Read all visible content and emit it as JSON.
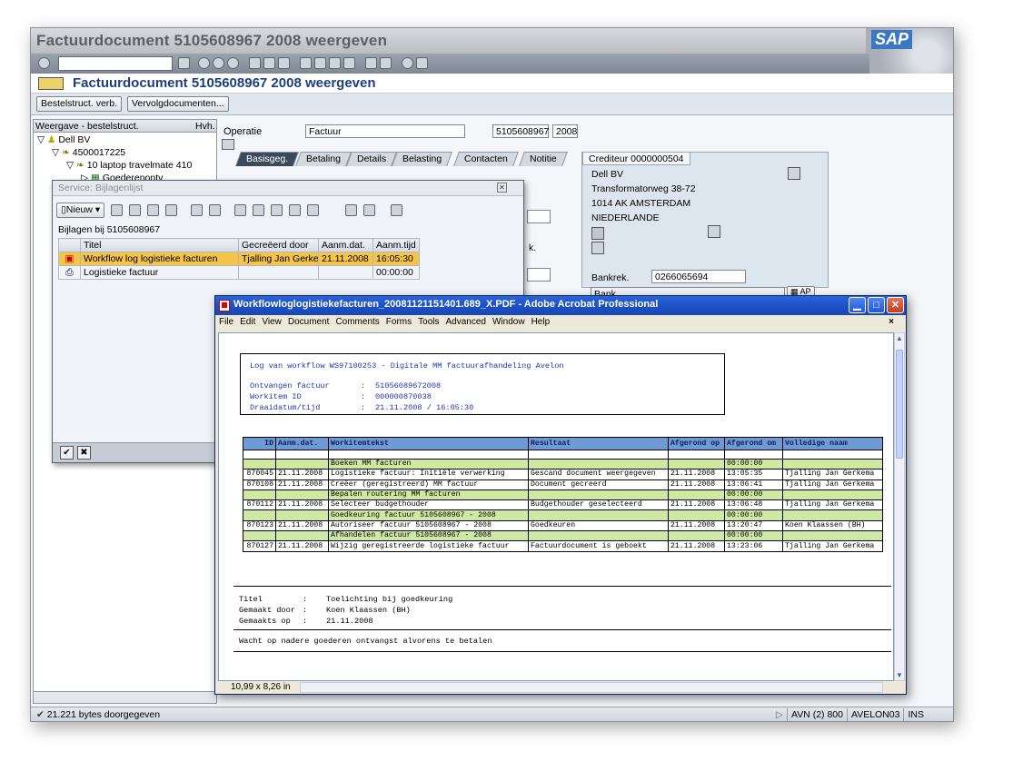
{
  "sap": {
    "title": "Factuurdocument 5105608967 2008 weergeven",
    "logo": "SAP",
    "header_title": "Factuurdocument 5105608967 2008 weergeven",
    "buttons": {
      "bestelstruct": "Bestelstruct. verb.",
      "vervolg": "Vervolgdocumenten..."
    },
    "tree": {
      "col1": "Weergave - bestelstruct.",
      "col2": "Hvh.",
      "items": [
        "Dell BV",
        "4500017225",
        "10 laptop travelmate 410",
        "Goederenontv."
      ]
    },
    "operatie_label": "Operatie",
    "operatie_value": "Factuur",
    "doc_number": "5105608967",
    "doc_year": "2008",
    "tabs": [
      "Basisgeg.",
      "Betaling",
      "Details",
      "Belasting",
      "Contacten",
      "Notitie"
    ],
    "crediteur": {
      "title": "Crediteur 0000000504",
      "lines": [
        "Dell BV",
        "Transformatorweg 38-72",
        "1014 AK AMSTERDAM",
        "NIEDERLANDE"
      ],
      "bankrek_label": "Bankrek.",
      "bankrek_value": "0266065694",
      "bank_label": "Bank",
      "ap_button": "AP"
    },
    "partial_labels": {
      "k": "k."
    },
    "status": {
      "message": "21.221 bytes doorgegeven",
      "system": "AVN (2) 800",
      "server": "AVELON03",
      "mode": "INS"
    }
  },
  "bijlagen": {
    "title": "Service: Bijlagenlijst",
    "nieuw": "Nieuw",
    "label": "Bijlagen bij 5105608967",
    "columns": [
      "Titel",
      "Gecreëerd door",
      "Aanm.dat.",
      "Aanm.tijd"
    ],
    "rows": [
      {
        "titel": "Workflow log logistieke facturen",
        "door": "Tjalling Jan Gerkema",
        "datum": "21.11.2008",
        "tijd": "16:05:30"
      },
      {
        "titel": "Logistieke factuur",
        "door": "",
        "datum": "",
        "tijd": "00:00:00"
      }
    ]
  },
  "acrobat": {
    "title": "Workflowloglogistiekefacturen_20081121151401.689_X.PDF - Adobe Acrobat Professional",
    "menu": [
      "File",
      "Edit",
      "View",
      "Document",
      "Comments",
      "Forms",
      "Tools",
      "Advanced",
      "Window",
      "Help"
    ],
    "page_size": "10,99 x 8,26 in",
    "doc": {
      "log_title": "Log van workflow WS97100253  - Digitale MM factuurafhandeling Avelon",
      "meta": [
        {
          "label": "Ontvangen factuur",
          "value": "51056089672008"
        },
        {
          "label": "Workitem ID",
          "value": "000000870038"
        },
        {
          "label": "Draaidatum/tijd",
          "value": "21.11.2008 / 16:05:30"
        }
      ],
      "columns": [
        "ID",
        "Aanm.dat.",
        "Workitemtekst",
        "Resultaat",
        "Afgerond op",
        "Afgerond om",
        "Volledige naam"
      ],
      "rows": [
        {
          "type": "g",
          "id": "",
          "datum": "",
          "tekst": "Boeken MM facturen",
          "resultaat": "",
          "op": "",
          "om": "00:00:00",
          "naam": ""
        },
        {
          "type": "n",
          "id": "870045",
          "datum": "21.11.2008",
          "tekst": "Logistieke factuur: Initiële verwerking",
          "resultaat": "Gescand document weergegeven",
          "op": "21.11.2008",
          "om": "13:05:35",
          "naam": "Tjalling Jan Gerkema"
        },
        {
          "type": "n",
          "id": "870108",
          "datum": "21.11.2008",
          "tekst": "Creëer (geregistreerd) MM factuur",
          "resultaat": "Document gecreerd",
          "op": "21.11.2008",
          "om": "13:06:41",
          "naam": "Tjalling Jan Gerkema"
        },
        {
          "type": "g",
          "id": "",
          "datum": "",
          "tekst": "Bepalen routering MM facturen",
          "resultaat": "",
          "op": "",
          "om": "00:00:00",
          "naam": ""
        },
        {
          "type": "n",
          "id": "870112",
          "datum": "21.11.2008",
          "tekst": "Selecteer budgethouder",
          "resultaat": "Budgethouder geselecteerd",
          "op": "21.11.2008",
          "om": "13:06:48",
          "naam": "Tjalling Jan Gerkema"
        },
        {
          "type": "g",
          "id": "",
          "datum": "",
          "tekst": "Goedkeuring factuur 5105608967 - 2008",
          "resultaat": "",
          "op": "",
          "om": "00:00:00",
          "naam": ""
        },
        {
          "type": "n",
          "id": "870123",
          "datum": "21.11.2008",
          "tekst": "Autoriseer factuur 5105608967 - 2008",
          "resultaat": "Goedkeuren",
          "op": "21.11.2008",
          "om": "13:20:47",
          "naam": "Koen Klaassen (BH)"
        },
        {
          "type": "g",
          "id": "",
          "datum": "",
          "tekst": "Afhandelen factuur 5105608967 - 2008",
          "resultaat": "",
          "op": "",
          "om": "00:00:00",
          "naam": ""
        },
        {
          "type": "n",
          "id": "870127",
          "datum": "21.11.2008",
          "tekst": "Wijzig geregistreerde logistieke factuur",
          "resultaat": "Factuurdocument  is geboekt",
          "op": "21.11.2008",
          "om": "13:23:06",
          "naam": "Tjalling Jan Gerkema"
        }
      ],
      "note": [
        {
          "label": "Titel",
          "value": "Toelichting bij goedkeuring"
        },
        {
          "label": "Gemaakt door",
          "value": "Koen Klaassen (BH)"
        },
        {
          "label": "Gemaakts op",
          "value": "21.11.2008"
        }
      ],
      "note_text": "Wacht op nadere goederen ontvangst alvorens te betalen"
    }
  }
}
